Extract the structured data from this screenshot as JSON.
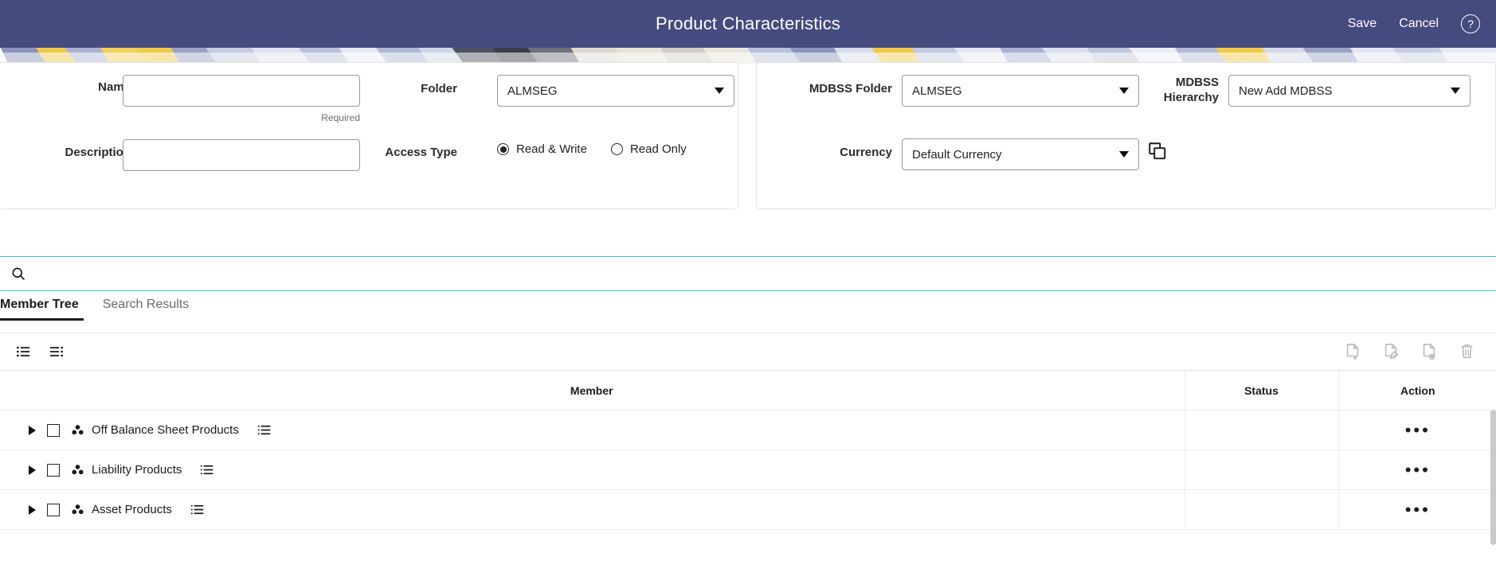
{
  "appbar": {
    "title": "Product Characteristics",
    "save_label": "Save",
    "cancel_label": "Cancel",
    "help_glyph": "?",
    "background_color": "#454b7f"
  },
  "form": {
    "name": {
      "label": "Name",
      "value": "",
      "placeholder": "",
      "required_note": "Required"
    },
    "description": {
      "label": "Description",
      "value": "",
      "placeholder": ""
    },
    "folder": {
      "label": "Folder",
      "value": "ALMSEG"
    },
    "access_type": {
      "label": "Access Type",
      "options": [
        {
          "label": "Read & Write",
          "selected": true
        },
        {
          "label": "Read Only",
          "selected": false
        }
      ]
    },
    "mdbss_folder": {
      "label": "MDBSS Folder",
      "value": "ALMSEG"
    },
    "mdbss_hierarchy": {
      "label": "MDBSS Hierarchy",
      "label_line1": "MDBSS",
      "label_line2": "Hierarchy",
      "value": "New Add MDBSS"
    },
    "currency": {
      "label": "Currency",
      "value": "Default Currency"
    },
    "copy_button_name": "copy-icon"
  },
  "search": {
    "value": "",
    "placeholder": "",
    "icon": "search-icon",
    "focus_color": "#3fc0c4"
  },
  "tabs": [
    {
      "label": "Member Tree",
      "active": true
    },
    {
      "label": "Search Results",
      "active": false
    }
  ],
  "tree_toolbar": {
    "left_icons": [
      {
        "name": "expand-list-icon"
      },
      {
        "name": "collapse-list-icon"
      }
    ],
    "right_icons": [
      {
        "name": "add-document-icon"
      },
      {
        "name": "edit-document-icon"
      },
      {
        "name": "view-document-icon"
      },
      {
        "name": "delete-document-icon"
      }
    ]
  },
  "table": {
    "columns": [
      "Member",
      "Status",
      "Action"
    ],
    "rows": [
      {
        "member": "Off Balance Sheet Products",
        "status": "",
        "action": "•••",
        "expanded": false,
        "checked": false
      },
      {
        "member": "Liability Products",
        "status": "",
        "action": "•••",
        "expanded": false,
        "checked": false
      },
      {
        "member": "Asset Products",
        "status": "",
        "action": "•••",
        "expanded": false,
        "checked": false
      }
    ]
  }
}
